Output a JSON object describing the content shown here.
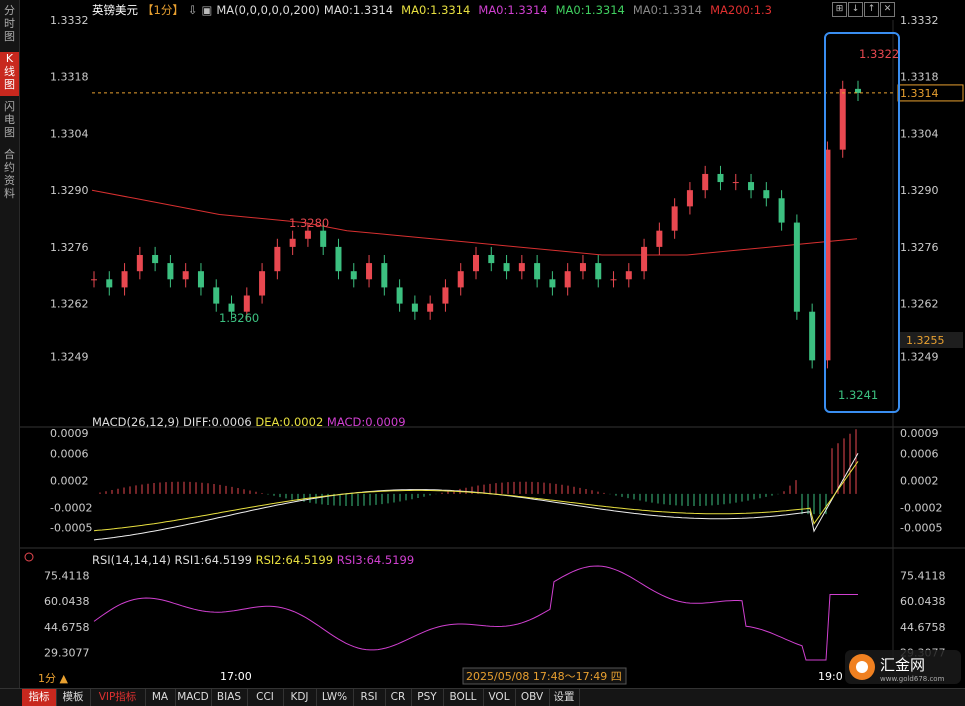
{
  "sidebar": {
    "tabs": [
      {
        "label": "分时图",
        "active": false
      },
      {
        "label": "K线图",
        "active": true
      },
      {
        "label": "闪电图",
        "active": false
      },
      {
        "label": "合约资料",
        "active": false
      }
    ]
  },
  "header": {
    "symbol": "英镑美元",
    "period": "【1分】",
    "dropdown_glyph": "⇩",
    "ma_label": "MA(0,0,0,0,0,200)",
    "ma_values": [
      {
        "text": "MA0:1.3314",
        "color": "#dddddd"
      },
      {
        "text": "MA0:1.3314",
        "color": "#e8e040"
      },
      {
        "text": "MA0:1.3314",
        "color": "#d040d0"
      },
      {
        "text": "MA0:1.3314",
        "color": "#40d060"
      },
      {
        "text": "MA0:1.3314",
        "color": "#888888"
      },
      {
        "text": "MA200:1.3",
        "color": "#e03030"
      }
    ]
  },
  "window_buttons": [
    "⊞",
    "↓",
    "↑",
    "✕"
  ],
  "price_axis": {
    "ticks": [
      "1.3332",
      "1.3318",
      "1.3304",
      "1.3290",
      "1.3276",
      "1.3262",
      "1.3249"
    ],
    "current": "1.3314",
    "cursor": "1.3255"
  },
  "annotations": {
    "high1": "1.3280",
    "low1": "1.3260",
    "high2": "1.3322",
    "low2": "1.3241"
  },
  "macd": {
    "label": "MACD(26,12,9)",
    "diff": "DIFF:0.0006",
    "dea": "DEA:0.0002",
    "macd": "MACD:0.0009",
    "ticks": [
      "0.0009",
      "0.0006",
      "0.0002",
      "-0.0002",
      "-0.0005"
    ]
  },
  "rsi": {
    "label": "RSI(14,14,14)",
    "rsi1": "RSI1:64.5199",
    "rsi2": "RSI2:64.5199",
    "rsi3": "RSI3:64.5199",
    "ticks": [
      "75.4118",
      "60.0438",
      "44.6758",
      "29.3077"
    ]
  },
  "time_axis": {
    "left": "17:00",
    "right": "19:0",
    "cursor": "2025/05/08 17:48～17:49 四",
    "period_btn": "1分 ▲"
  },
  "toolbar": {
    "items": [
      "指标",
      "模板",
      "VIP指标",
      "MA",
      "MACD",
      "BIAS",
      "CCI",
      "KDJ",
      "LW%",
      "RSI",
      "CR",
      "PSY",
      "BOLL",
      "VOL",
      "OBV",
      "设置"
    ]
  },
  "logo": {
    "brand": "汇金网",
    "url": "www.gold678.com"
  },
  "chart_data": {
    "type": "candlestick",
    "title": "英镑美元 1分",
    "ylim": [
      1.3241,
      1.3332
    ],
    "indicators": [
      "MA200",
      "MACD",
      "RSI"
    ],
    "series": [
      {
        "name": "close",
        "values": [
          1.3268,
          1.3266,
          1.327,
          1.3274,
          1.3272,
          1.3268,
          1.327,
          1.3266,
          1.3262,
          1.326,
          1.3264,
          1.327,
          1.3276,
          1.3278,
          1.328,
          1.3276,
          1.327,
          1.3268,
          1.3272,
          1.3266,
          1.3262,
          1.326,
          1.3262,
          1.3266,
          1.327,
          1.3274,
          1.3272,
          1.327,
          1.3272,
          1.3268,
          1.3266,
          1.327,
          1.3272,
          1.3268,
          1.3268,
          1.327,
          1.3276,
          1.328,
          1.3286,
          1.329,
          1.3294,
          1.3292,
          1.3292,
          1.329,
          1.3288,
          1.3282,
          1.326,
          1.3248,
          1.33,
          1.3315,
          1.3314
        ]
      }
    ]
  }
}
